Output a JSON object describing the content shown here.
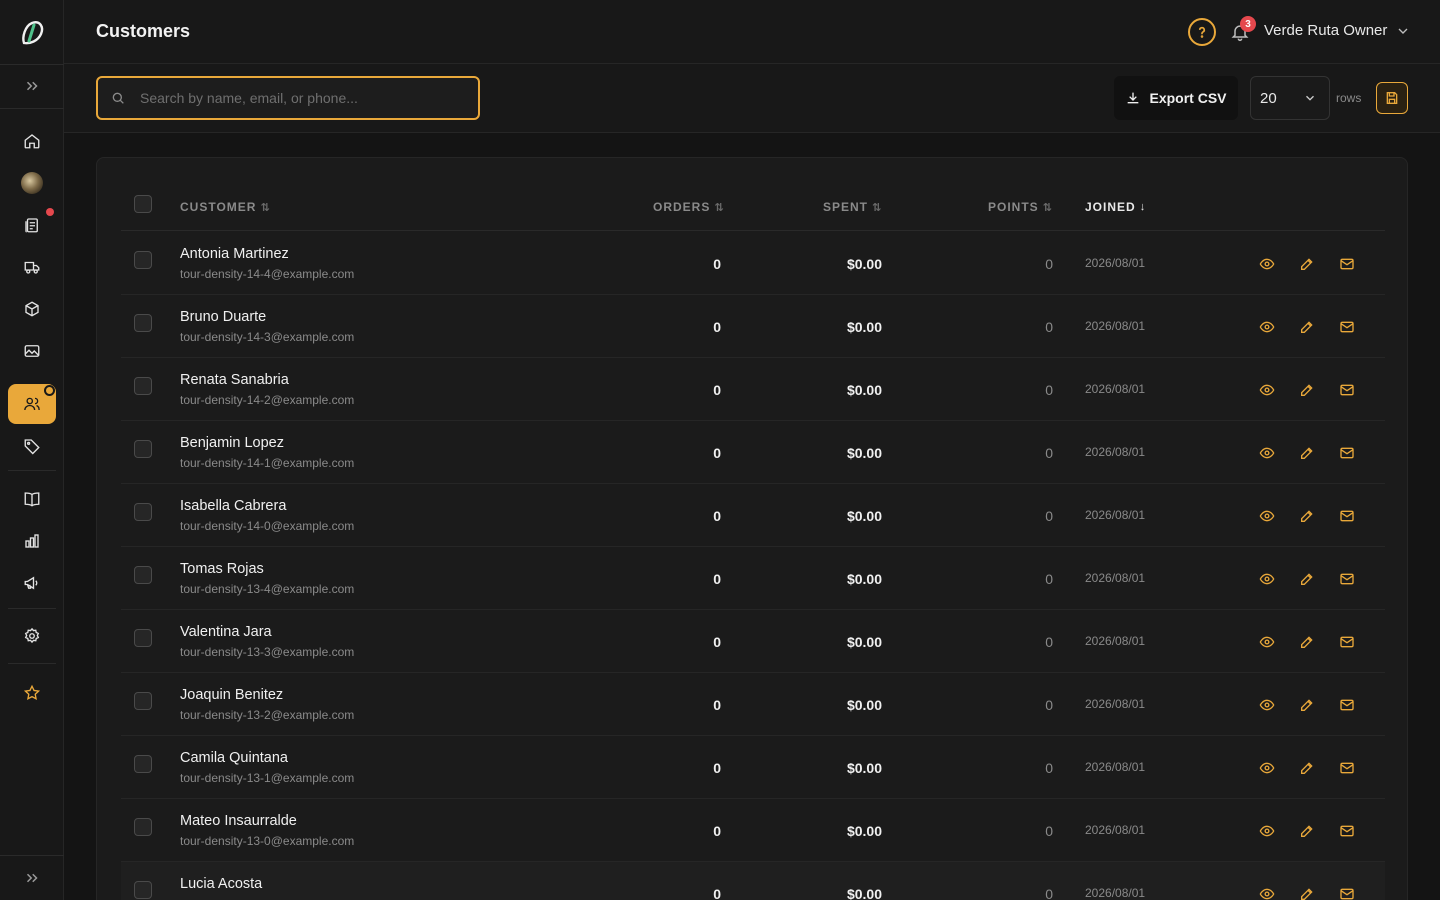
{
  "header": {
    "title": "Customers",
    "notification_count": "3",
    "user_name": "Verde Ruta Owner"
  },
  "toolbar": {
    "search_placeholder": "Search by name, email, or phone...",
    "search_value": "",
    "export_label": "Export CSV",
    "rows_value": "20",
    "rows_label": "rows"
  },
  "table": {
    "columns": {
      "customer": "CUSTOMER",
      "orders": "ORDERS",
      "spent": "SPENT",
      "points": "POINTS",
      "joined": "JOINED"
    },
    "rows": [
      {
        "name": "Antonia Martinez",
        "email": "tour-density-14-4@example.com",
        "orders": "0",
        "spent": "$0.00",
        "points": "0",
        "joined": "2026/08/01"
      },
      {
        "name": "Bruno Duarte",
        "email": "tour-density-14-3@example.com",
        "orders": "0",
        "spent": "$0.00",
        "points": "0",
        "joined": "2026/08/01"
      },
      {
        "name": "Renata Sanabria",
        "email": "tour-density-14-2@example.com",
        "orders": "0",
        "spent": "$0.00",
        "points": "0",
        "joined": "2026/08/01"
      },
      {
        "name": "Benjamin Lopez",
        "email": "tour-density-14-1@example.com",
        "orders": "0",
        "spent": "$0.00",
        "points": "0",
        "joined": "2026/08/01"
      },
      {
        "name": "Isabella Cabrera",
        "email": "tour-density-14-0@example.com",
        "orders": "0",
        "spent": "$0.00",
        "points": "0",
        "joined": "2026/08/01"
      },
      {
        "name": "Tomas Rojas",
        "email": "tour-density-13-4@example.com",
        "orders": "0",
        "spent": "$0.00",
        "points": "0",
        "joined": "2026/08/01"
      },
      {
        "name": "Valentina Jara",
        "email": "tour-density-13-3@example.com",
        "orders": "0",
        "spent": "$0.00",
        "points": "0",
        "joined": "2026/08/01"
      },
      {
        "name": "Joaquin Benitez",
        "email": "tour-density-13-2@example.com",
        "orders": "0",
        "spent": "$0.00",
        "points": "0",
        "joined": "2026/08/01"
      },
      {
        "name": "Camila Quintana",
        "email": "tour-density-13-1@example.com",
        "orders": "0",
        "spent": "$0.00",
        "points": "0",
        "joined": "2026/08/01"
      },
      {
        "name": "Mateo Insaurralde",
        "email": "tour-density-13-0@example.com",
        "orders": "0",
        "spent": "$0.00",
        "points": "0",
        "joined": "2026/08/01"
      },
      {
        "name": "Lucia Acosta",
        "email": "",
        "orders": "0",
        "spent": "$0.00",
        "points": "0",
        "joined": "2026/08/01"
      }
    ]
  },
  "sidebar": {
    "items": [
      {
        "name": "home-icon"
      },
      {
        "name": "avatar"
      },
      {
        "name": "orders-icon"
      },
      {
        "name": "delivery-truck-icon"
      },
      {
        "name": "package-icon"
      },
      {
        "name": "image-icon"
      },
      {
        "name": "customers-icon"
      },
      {
        "name": "tag-icon"
      },
      {
        "name": "book-icon"
      },
      {
        "name": "bar-chart-icon"
      },
      {
        "name": "megaphone-icon"
      },
      {
        "name": "gear-icon"
      },
      {
        "name": "star-icon"
      }
    ]
  },
  "colors": {
    "accent": "#e9a83a",
    "background": "#141414",
    "danger": "#e5484d"
  }
}
